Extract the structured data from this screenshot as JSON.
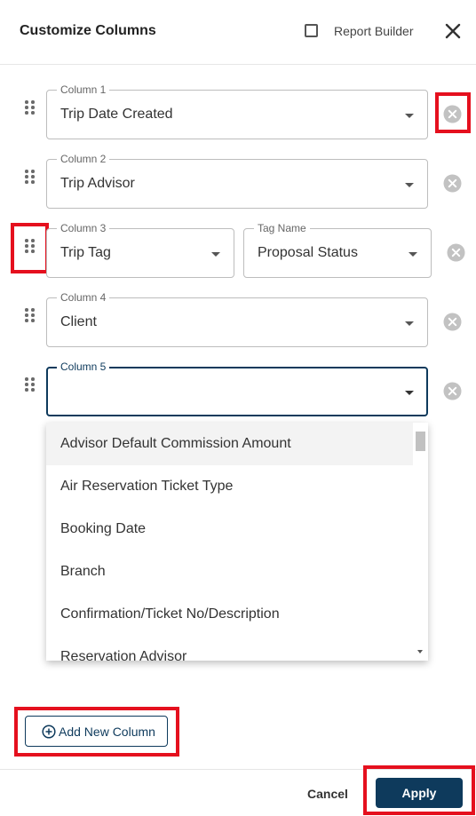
{
  "header": {
    "title": "Customize Columns",
    "report_builder_label": "Report Builder",
    "report_builder_checked": false,
    "close_icon": "close-icon"
  },
  "columns": [
    {
      "label": "Column 1",
      "value": "Trip Date Created"
    },
    {
      "label": "Column 2",
      "value": "Trip Advisor"
    },
    {
      "label": "Column 3",
      "value": "Trip Tag",
      "tag_label": "Tag Name",
      "tag_value": "Proposal Status"
    },
    {
      "label": "Column 4",
      "value": "Client"
    },
    {
      "label": "Column 5",
      "value": ""
    }
  ],
  "dropdown": {
    "options": [
      "Advisor Default Commission Amount",
      "Air Reservation Ticket Type",
      "Booking Date",
      "Branch",
      "Confirmation/Ticket No/Description",
      "Reservation Advisor"
    ],
    "highlighted_index": 0
  },
  "actions": {
    "add_column_label": "Add New Column",
    "cancel_label": "Cancel",
    "apply_label": "Apply"
  },
  "colors": {
    "primary": "#0e3a5c",
    "highlight": "#e5101e"
  }
}
